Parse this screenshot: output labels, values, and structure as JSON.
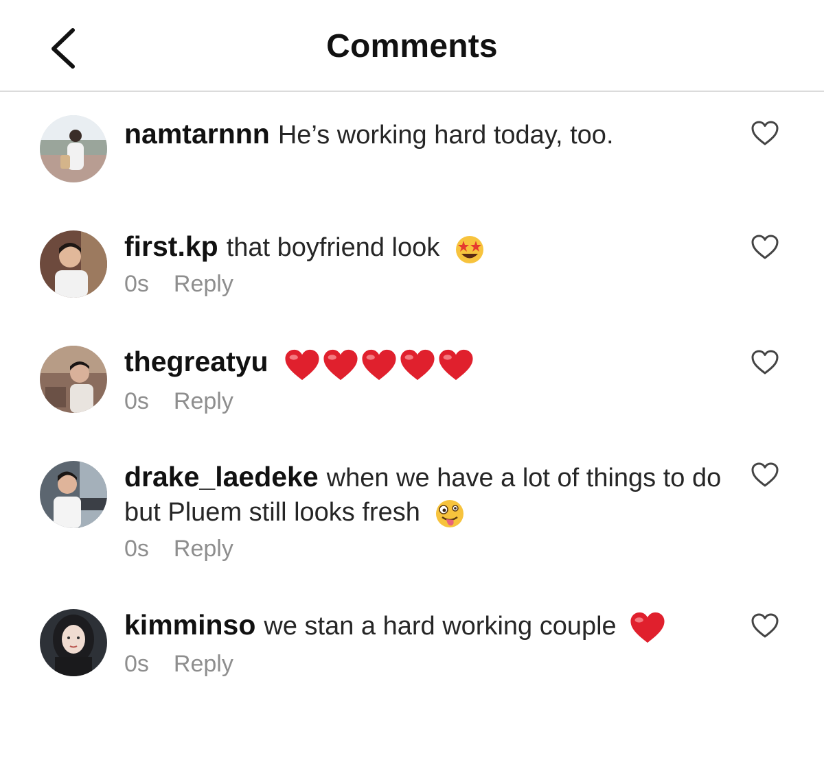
{
  "header": {
    "title": "Comments"
  },
  "comments": [
    {
      "username": "namtarnnn",
      "text": "He’s working hard today, too.",
      "time": "",
      "reply_label": ""
    },
    {
      "username": "first.kp",
      "text": "that boyfriend look",
      "emoji": "star-struck-emoji",
      "time": "0s",
      "reply_label": "Reply"
    },
    {
      "username": "thegreatyu",
      "text": "",
      "emoji": "red-heart-emoji x5",
      "time": "0s",
      "reply_label": "Reply"
    },
    {
      "username": "drake_laedeke",
      "text": "when we have a lot of things to do but Pluem still looks fresh",
      "emoji": "zany-face-emoji",
      "time": "0s",
      "reply_label": "Reply"
    },
    {
      "username": "kimminso",
      "text": "we stan a hard working couple",
      "emoji": "red-heart-emoji",
      "time": "0s",
      "reply_label": "Reply"
    }
  ],
  "colors": {
    "text": "#262626",
    "muted": "#8e8e8e",
    "divider": "#dbdbdb",
    "heart_emoji": "#e0202d"
  },
  "icons": {
    "back": "chevron-left-icon",
    "like": "heart-outline-icon"
  }
}
